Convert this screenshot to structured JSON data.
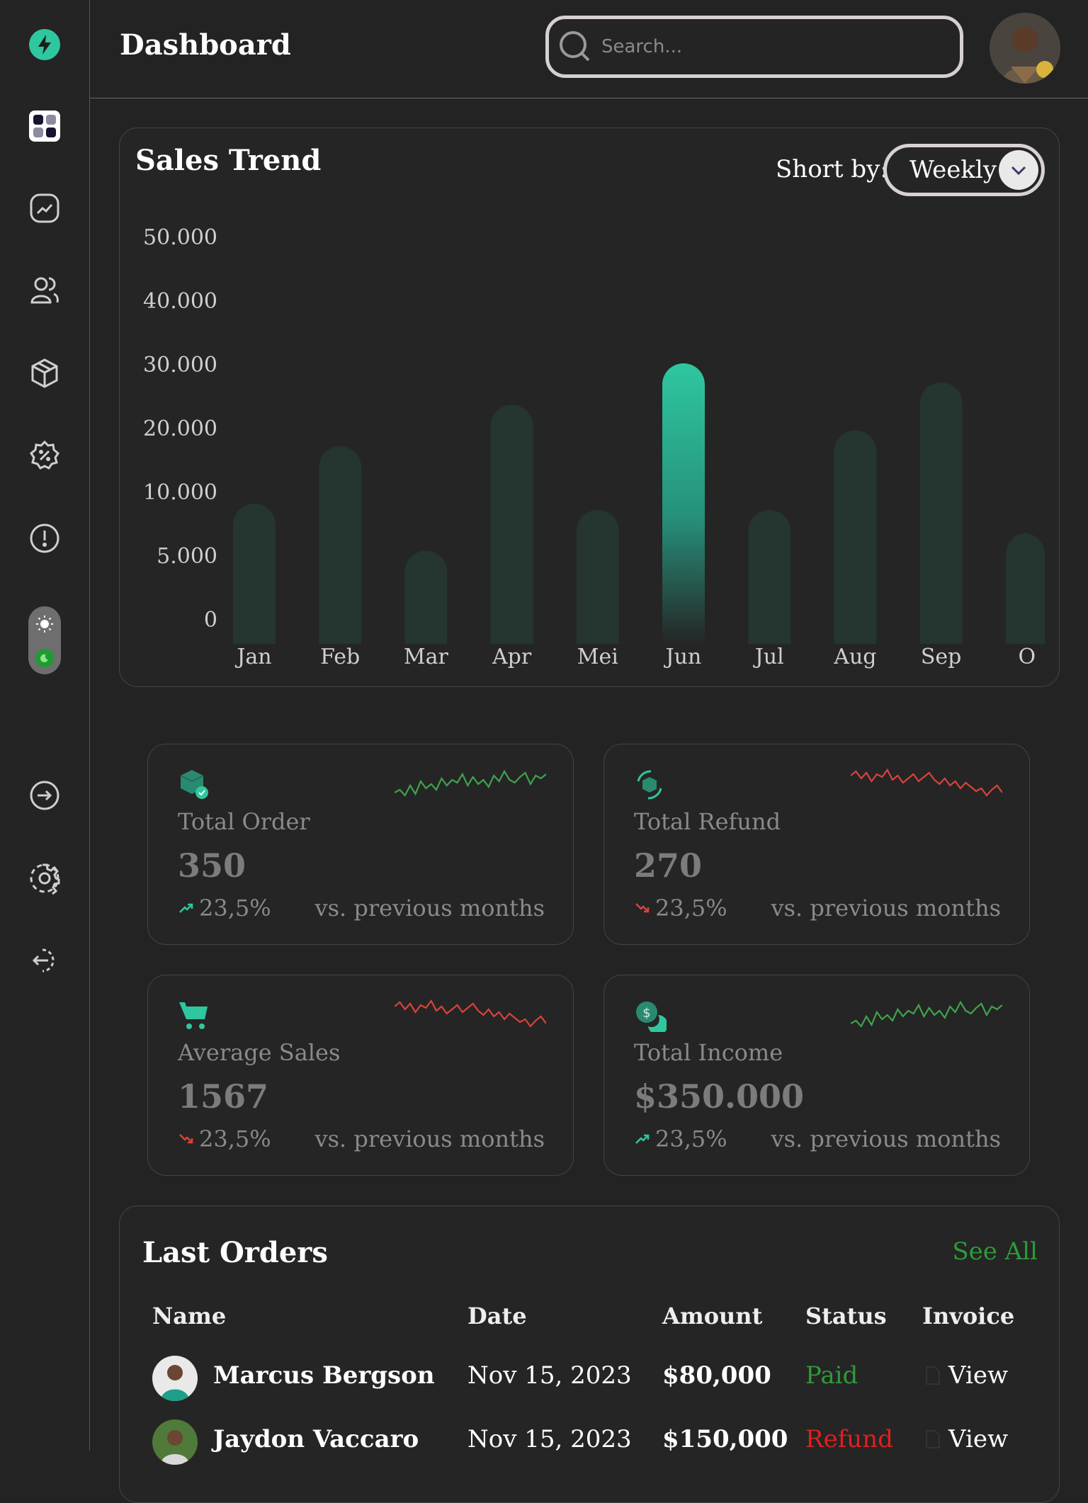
{
  "header": {
    "title": "Dashboard",
    "search_placeholder": "Search..."
  },
  "sidebar": {
    "items": [
      {
        "name": "logo",
        "icon": "lightning-icon"
      },
      {
        "name": "dashboard",
        "icon": "grid-icon"
      },
      {
        "name": "analytics",
        "icon": "chart-icon"
      },
      {
        "name": "users",
        "icon": "users-icon"
      },
      {
        "name": "products",
        "icon": "box-icon"
      },
      {
        "name": "discount",
        "icon": "discount-icon"
      },
      {
        "name": "alerts",
        "icon": "alert-icon"
      },
      {
        "name": "login",
        "icon": "login-icon"
      },
      {
        "name": "settings",
        "icon": "gear-icon"
      },
      {
        "name": "logout",
        "icon": "logout-icon"
      }
    ],
    "theme": "dark"
  },
  "sales": {
    "title": "Sales Trend",
    "sort_label": "Short by:",
    "sort_value": "Weekly"
  },
  "chart_data": {
    "type": "bar",
    "categories": [
      "Jan",
      "Feb",
      "Mar",
      "Apr",
      "Mei",
      "Jun",
      "Jul",
      "Aug",
      "Sep",
      "Oct"
    ],
    "category_labels": [
      "Jan",
      "Feb",
      "Mar",
      "Apr",
      "Mei",
      "Jun",
      "Jul",
      "Aug",
      "Sep",
      "O"
    ],
    "values": [
      9000,
      17000,
      5300,
      23500,
      8500,
      30000,
      8500,
      19500,
      27000,
      6700
    ],
    "y_ticks": [
      "0",
      "5.000",
      "10.000",
      "20.000",
      "30.000",
      "40.000",
      "50.000"
    ],
    "highlight_index": 5,
    "bar_color": "#253530",
    "highlight_color": "#2fc79f",
    "title": "Sales Trend"
  },
  "stats": [
    {
      "label": "Total Order",
      "value": "350",
      "change": "23,5%",
      "trend": "up",
      "vs": "vs. previous months",
      "icon": "box-check-icon"
    },
    {
      "label": "Total Refund",
      "value": "270",
      "change": "23,5%",
      "trend": "down",
      "vs": "vs. previous months",
      "icon": "refund-icon"
    },
    {
      "label": "Average Sales",
      "value": "1567",
      "change": "23,5%",
      "trend": "down",
      "vs": "vs. previous months",
      "icon": "cart-icon"
    },
    {
      "label": "Total Income",
      "value": "$350.000",
      "change": "23,5%",
      "trend": "up",
      "vs": "vs. previous months",
      "icon": "coin-icon"
    }
  ],
  "orders": {
    "title": "Last Orders",
    "see_all": "See All",
    "columns": [
      "Name",
      "Date",
      "Amount",
      "Status",
      "Invoice"
    ],
    "rows": [
      {
        "name": "Marcus Bergson",
        "date": "Nov 15, 2023",
        "amount": "$80,000",
        "status": "Paid",
        "invoice": "View"
      },
      {
        "name": "Jaydon Vaccaro",
        "date": "Nov 15, 2023",
        "amount": "$150,000",
        "status": "Refund",
        "invoice": "View"
      }
    ],
    "status_colors": {
      "Paid": "#2d9b3a",
      "Refund": "#e0201c"
    }
  },
  "colors": {
    "accent": "#2fc79f",
    "up": "#3fa34d",
    "down": "#d9433b"
  }
}
